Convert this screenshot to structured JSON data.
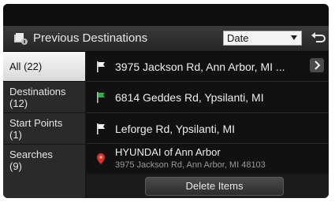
{
  "header": {
    "title": "Previous Destinations",
    "sort_selected": "Date",
    "icons": [
      "destinations-icon",
      "dropdown-arrow-icon",
      "back-icon"
    ]
  },
  "sidebar": {
    "items": [
      {
        "label": "All",
        "count": "(22)",
        "active": true
      },
      {
        "label": "Destinations",
        "count": "(12)",
        "active": false
      },
      {
        "label": "Start Points",
        "count": "(1)",
        "active": false
      },
      {
        "label": "Searches",
        "count": "(9)",
        "active": false
      }
    ]
  },
  "list": {
    "items": [
      {
        "text": "3975 Jackson Rd, Ann Arbor, MI ...",
        "icon": "white-flag-icon"
      },
      {
        "text": "6814 Geddes Rd, Ypsilanti, MI",
        "icon": "green-flag-icon"
      },
      {
        "text": "Leforge Rd, Ypsilanti, MI",
        "icon": "white-flag-icon"
      },
      {
        "text": "HYUNDAI of Ann Arbor",
        "subtext": "3975 Jackson Rd, Ann Arbor, MI 48103",
        "icon": "map-pin-icon"
      }
    ]
  },
  "footer": {
    "delete_label": "Delete Items"
  },
  "colors": {
    "background": "#151515",
    "active_tab": "#e9e9e9",
    "flag_green": "#2fb14a",
    "pin_red": "#d8332b"
  }
}
